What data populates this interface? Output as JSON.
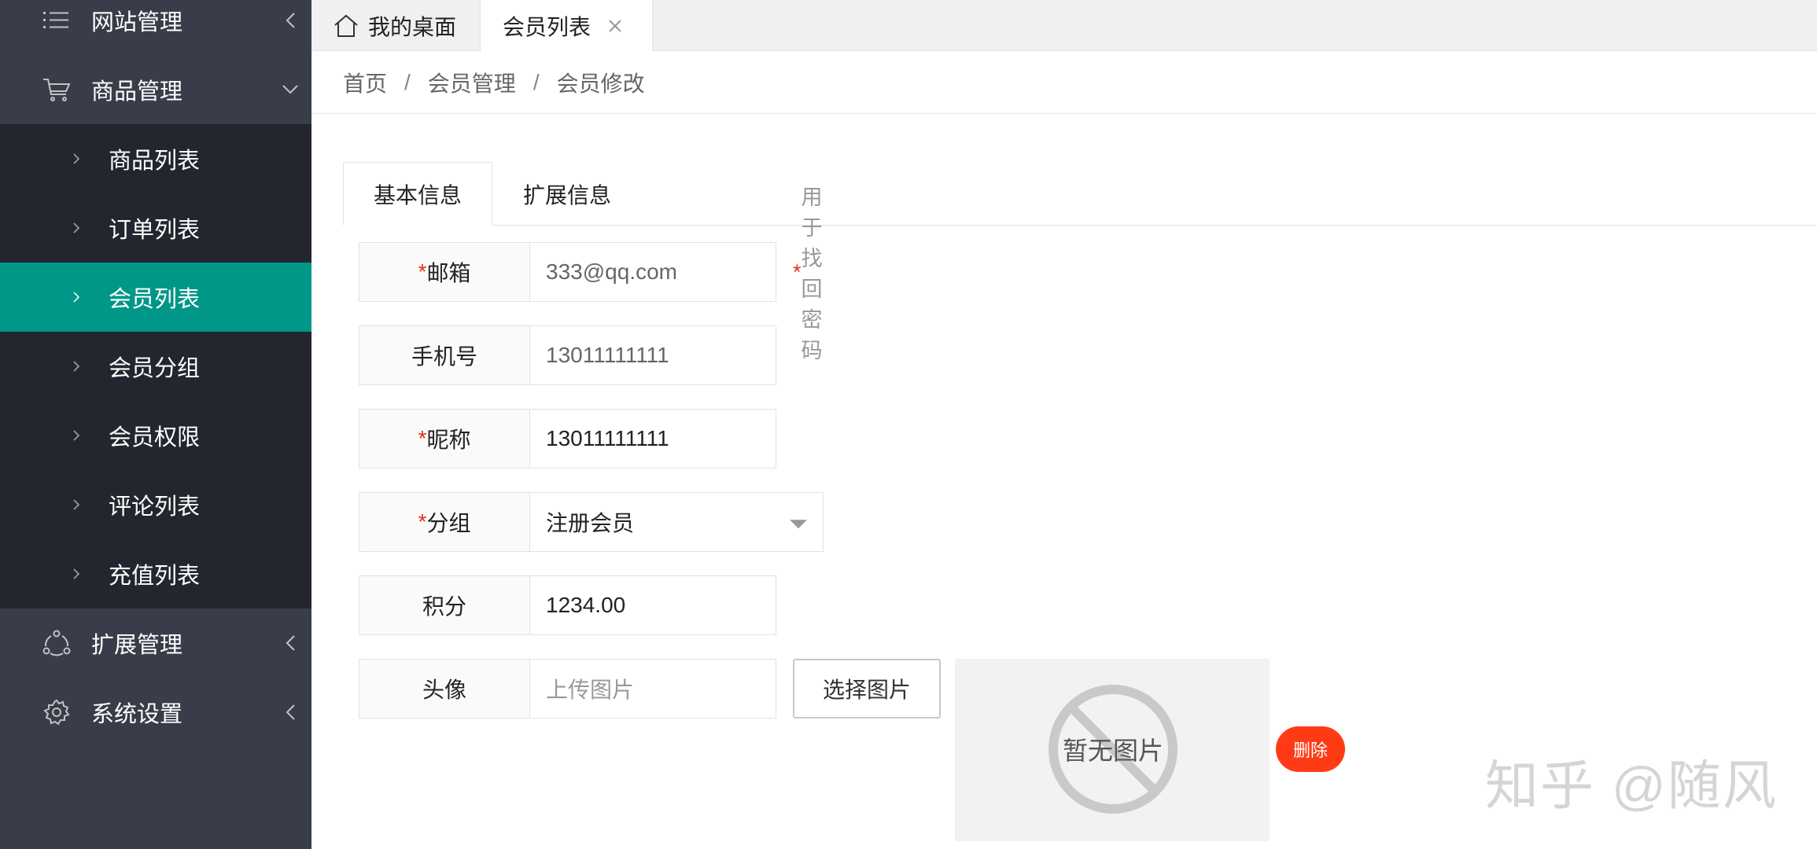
{
  "sidebar": {
    "groups": [
      {
        "label": "网站管理",
        "icon": "list-icon"
      },
      {
        "label": "商品管理",
        "icon": "cart-icon"
      },
      {
        "label": "扩展管理",
        "icon": "network-icon"
      },
      {
        "label": "系统设置",
        "icon": "gear-icon"
      }
    ],
    "items": [
      {
        "label": "商品列表"
      },
      {
        "label": "订单列表"
      },
      {
        "label": "会员列表"
      },
      {
        "label": "会员分组"
      },
      {
        "label": "会员权限"
      },
      {
        "label": "评论列表"
      },
      {
        "label": "充值列表"
      }
    ],
    "active_color": "#009688"
  },
  "topbar": {
    "home_tab": "我的桌面",
    "active_tab": "会员列表"
  },
  "breadcrumb": [
    "首页",
    "会员管理",
    "会员修改"
  ],
  "form_tabs": [
    "基本信息",
    "扩展信息"
  ],
  "form": {
    "email": {
      "label": "邮箱",
      "value": "333@qq.com",
      "hint": "用于找回密码"
    },
    "phone": {
      "label": "手机号",
      "value": "13011111111"
    },
    "nickname": {
      "label": "昵称",
      "value": "13011111111"
    },
    "group": {
      "label": "分组",
      "value": "注册会员"
    },
    "points": {
      "label": "积分",
      "value": "1234.00"
    },
    "avatar": {
      "label": "头像",
      "placeholder": "上传图片",
      "button": "选择图片"
    },
    "required_mark": "*"
  },
  "preview": {
    "empty_text": "暂无图片",
    "delete_label": "删除"
  },
  "watermark": "知乎 @随风",
  "colors": {
    "accent": "#009688",
    "danger": "#ff3b16",
    "required": "#e0301e"
  }
}
